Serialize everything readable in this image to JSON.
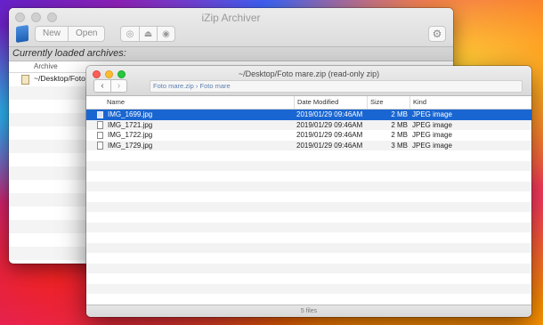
{
  "back_window": {
    "title": "iZip Archiver",
    "toolbar": {
      "new_label": "New",
      "open_label": "Open"
    },
    "loaded_label": "Currently loaded archives:",
    "column_archive": "Archive",
    "archive_row": "~/Desktop/Foto",
    "icons": [
      "cd-icon",
      "eject-icon",
      "disc-icon",
      "gear-icon"
    ]
  },
  "front_window": {
    "title": "~/Desktop/Foto mare.zip (read-only zip)",
    "path": "Foto mare.zip › Foto mare",
    "columns": {
      "name": "Name",
      "date": "Date Modified",
      "size": "Size",
      "kind": "Kind"
    },
    "files": [
      {
        "name": "IMG_1699.jpg",
        "date": "2019/01/29 09:46AM",
        "size": "2 MB",
        "kind": "JPEG image",
        "selected": true
      },
      {
        "name": "IMG_1721.jpg",
        "date": "2019/01/29 09:46AM",
        "size": "2 MB",
        "kind": "JPEG image",
        "selected": false
      },
      {
        "name": "IMG_1722.jpg",
        "date": "2019/01/29 09:46AM",
        "size": "2 MB",
        "kind": "JPEG image",
        "selected": false
      },
      {
        "name": "IMG_1729.jpg",
        "date": "2019/01/29 09:46AM",
        "size": "3 MB",
        "kind": "JPEG image",
        "selected": false
      }
    ],
    "status": "5 files"
  },
  "colors": {
    "selection": "#1966d2",
    "path_link": "#5b7fb0"
  }
}
